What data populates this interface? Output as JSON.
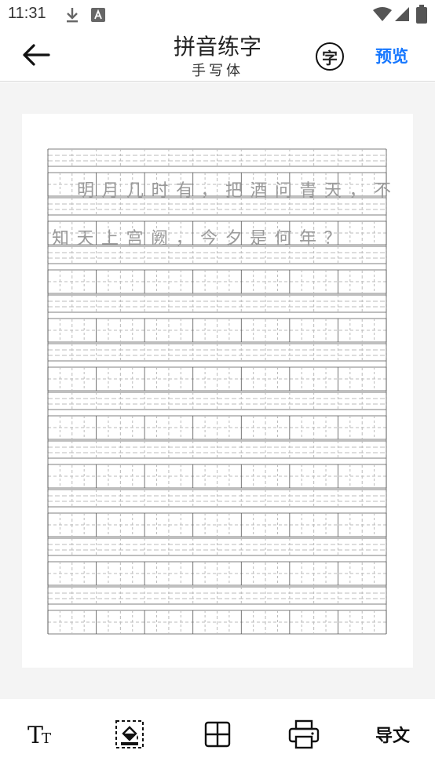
{
  "status_bar": {
    "time": "11:31",
    "icons": [
      "download-icon",
      "a-notification-icon",
      "wifi-icon",
      "signal-icon",
      "battery-icon"
    ]
  },
  "header": {
    "title": "拼音练字",
    "subtitle": "手写体",
    "char_button": "字",
    "preview_button": "预览"
  },
  "worksheet": {
    "lines": [
      "明月几时有，把酒问青天，不",
      "知天上宫阙，今夕是何年？"
    ]
  },
  "toolbar": {
    "text_tool": "TT",
    "export_label": "导文",
    "icons": [
      "text-size-icon",
      "fill-icon",
      "grid-icon",
      "print-icon"
    ]
  },
  "colors": {
    "accent": "#1677ff",
    "grid_line": "#555555",
    "grid_dash": "#bbbbbb"
  }
}
